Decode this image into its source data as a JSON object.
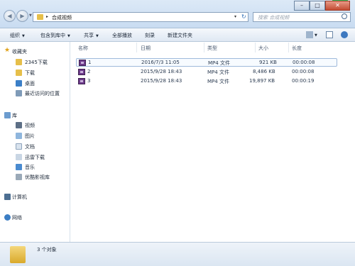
{
  "address": {
    "path": "合成视频"
  },
  "search": {
    "placeholder": "搜索 合成视频"
  },
  "toolbar": {
    "organize": "组织",
    "include_in_library": "包含到库中",
    "share": "共享",
    "play_all": "全部播放",
    "burn": "刻录",
    "new_folder": "新建文件夹"
  },
  "sidebar": {
    "favorites": "收藏夹",
    "fav_items": [
      "2345下载",
      "下载",
      "桌面",
      "最近访问的位置"
    ],
    "libraries": "库",
    "lib_items": [
      "视频",
      "图片",
      "文档",
      "迅雷下载",
      "音乐",
      "优酷影视库"
    ],
    "computer": "计算机",
    "network": "网络"
  },
  "columns": {
    "name": "名称",
    "date": "日期",
    "type": "类型",
    "size": "大小",
    "length": "长度"
  },
  "files": [
    {
      "name": "1",
      "date": "2016/7/3 11:05",
      "type": "MP4 文件",
      "size": "921 KB",
      "length": "00:00:08"
    },
    {
      "name": "2",
      "date": "2015/9/28 18:43",
      "type": "MP4 文件",
      "size": "8,486 KB",
      "length": "00:00:08"
    },
    {
      "name": "3",
      "date": "2015/9/28 18:43",
      "type": "MP4 文件",
      "size": "19,897 KB",
      "length": "00:00:19"
    }
  ],
  "status": {
    "count": "3 个对象"
  },
  "colors": {
    "accent": "#2f6fb8",
    "video_icon": "#6d3b8a",
    "folder": "#e6bf4a"
  }
}
